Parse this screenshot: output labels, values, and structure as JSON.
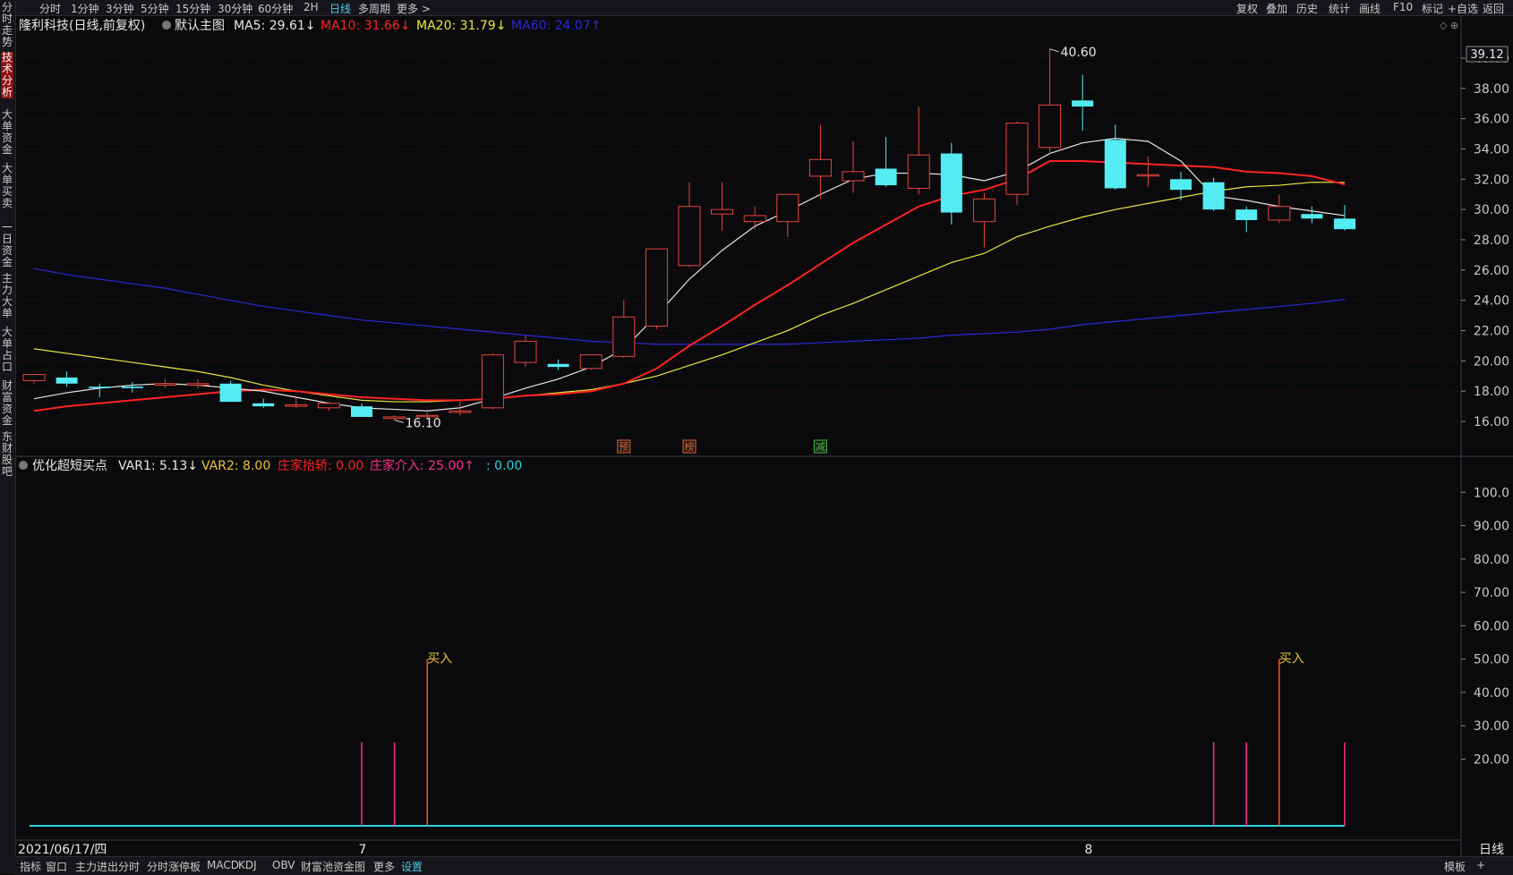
{
  "topbar": {
    "left_items": [
      "分时",
      "1分钟",
      "3分钟",
      "5分钟",
      "15分钟",
      "30分钟",
      "60分钟",
      "2H",
      "日线",
      "多周期",
      "更多 >"
    ],
    "selected": "日线",
    "right_items": [
      "复权",
      "叠加",
      "历史",
      "统计",
      "画线",
      "F10",
      "标记",
      "+自选",
      "返回"
    ]
  },
  "sidebar": {
    "tabs": [
      "分时走势",
      "技术分析",
      "大单资金",
      "大单买卖",
      "一日资金",
      "主力大单",
      "大单占口",
      "财富资金",
      "东财股吧"
    ],
    "active": "技术分析"
  },
  "colors": {
    "bg": "#0a0a0c",
    "up": "#e8453c",
    "down": "#54ecf2",
    "ma5": "#e6e6e6",
    "ma10": "#ff2222",
    "ma20": "#e8e840",
    "ma60": "#2a2ad8",
    "grid": "#3a0e0e",
    "axis": "#c8c8c8",
    "var": "#ff2f8f",
    "buy": "#ff5020",
    "buy_label": "#e8c040",
    "baseline": "#2fd0e0"
  },
  "price_panel": {
    "header": {
      "title": "隆利科技(日线,前复权)",
      "main_name": "默认主图",
      "ma5": "MA5: 29.61↓",
      "ma10": "MA10: 31.66↓",
      "ma20": "MA20: 31.79↓",
      "ma60": "MA60: 24.07↑"
    },
    "current_price": "39.12",
    "high_label": "40.60",
    "low_label": "16.10",
    "markers": [
      "预",
      "榜",
      "减"
    ]
  },
  "indicator_panel": {
    "header": {
      "name": "优化超短买点",
      "var1": "VAR1: 5.13↓",
      "var2": "VAR2: 8.00",
      "lift": "庄家抬轿: 0.00",
      "enter": "庄家介入: 25.00↑",
      "blank": ": 0.00"
    },
    "buy_label": "买入"
  },
  "xaxis": {
    "date": "2021/06/17/四",
    "month1": "7",
    "month2": "8",
    "period": "日线"
  },
  "bottombar": {
    "items": [
      "指标",
      "窗口",
      "主力进出分时",
      "分时涨停板",
      "MACD",
      "KDJ",
      "OBV",
      "财富池资金图",
      "更多",
      "设置"
    ],
    "right": [
      "模板",
      "+"
    ]
  },
  "chart_data": [
    {
      "type": "candlestick",
      "title": "隆利科技(日线,前复权)",
      "ylim": [
        15,
        41
      ],
      "yticks": [
        "16.00",
        "18.00",
        "20.00",
        "22.00",
        "24.00",
        "26.00",
        "28.00",
        "30.00",
        "32.00",
        "34.00",
        "36.00",
        "38.00",
        "40.00"
      ],
      "candles": [
        {
          "o": 18.7,
          "h": 19.1,
          "l": 18.5,
          "c": 19.1
        },
        {
          "o": 18.9,
          "h": 19.3,
          "l": 18.3,
          "c": 18.5
        },
        {
          "o": 18.3,
          "h": 18.5,
          "l": 17.6,
          "c": 18.2
        },
        {
          "o": 18.3,
          "h": 18.6,
          "l": 17.9,
          "c": 18.2
        },
        {
          "o": 18.4,
          "h": 18.8,
          "l": 18.2,
          "c": 18.5
        },
        {
          "o": 18.4,
          "h": 18.8,
          "l": 18.2,
          "c": 18.5
        },
        {
          "o": 18.5,
          "h": 18.7,
          "l": 17.3,
          "c": 17.3
        },
        {
          "o": 17.2,
          "h": 17.5,
          "l": 16.9,
          "c": 17.0
        },
        {
          "o": 17.0,
          "h": 17.6,
          "l": 16.9,
          "c": 17.1
        },
        {
          "o": 16.9,
          "h": 17.3,
          "l": 16.7,
          "c": 17.2
        },
        {
          "o": 17.0,
          "h": 17.2,
          "l": 16.3,
          "c": 16.3
        },
        {
          "o": 16.2,
          "h": 16.4,
          "l": 16.1,
          "c": 16.3
        },
        {
          "o": 16.4,
          "h": 16.6,
          "l": 16.2,
          "c": 16.4
        },
        {
          "o": 16.6,
          "h": 17.3,
          "l": 16.4,
          "c": 16.7
        },
        {
          "o": 16.9,
          "h": 20.5,
          "l": 16.8,
          "c": 20.4
        },
        {
          "o": 19.9,
          "h": 21.7,
          "l": 19.6,
          "c": 21.3
        },
        {
          "o": 19.8,
          "h": 20.1,
          "l": 19.4,
          "c": 19.6
        },
        {
          "o": 19.5,
          "h": 20.4,
          "l": 19.4,
          "c": 20.4
        },
        {
          "o": 20.3,
          "h": 24.0,
          "l": 20.2,
          "c": 22.9
        },
        {
          "o": 22.3,
          "h": 27.4,
          "l": 22.1,
          "c": 27.4
        },
        {
          "o": 26.3,
          "h": 31.8,
          "l": 26.2,
          "c": 30.2
        },
        {
          "o": 29.7,
          "h": 31.8,
          "l": 28.6,
          "c": 30.0
        },
        {
          "o": 29.2,
          "h": 30.2,
          "l": 28.7,
          "c": 29.6
        },
        {
          "o": 29.2,
          "h": 31.0,
          "l": 28.2,
          "c": 31.0
        },
        {
          "o": 32.2,
          "h": 35.6,
          "l": 30.7,
          "c": 33.3
        },
        {
          "o": 31.9,
          "h": 34.5,
          "l": 31.1,
          "c": 32.5
        },
        {
          "o": 32.7,
          "h": 34.8,
          "l": 31.5,
          "c": 31.6
        },
        {
          "o": 31.4,
          "h": 36.8,
          "l": 31.0,
          "c": 33.6
        },
        {
          "o": 33.7,
          "h": 34.4,
          "l": 29.0,
          "c": 29.8
        },
        {
          "o": 29.2,
          "h": 31.1,
          "l": 27.5,
          "c": 30.7
        },
        {
          "o": 31.0,
          "h": 35.8,
          "l": 30.3,
          "c": 35.7
        },
        {
          "o": 34.1,
          "h": 40.6,
          "l": 33.6,
          "c": 36.9
        },
        {
          "o": 37.2,
          "h": 38.9,
          "l": 35.2,
          "c": 36.8
        },
        {
          "o": 34.6,
          "h": 35.6,
          "l": 31.3,
          "c": 31.4
        },
        {
          "o": 32.3,
          "h": 33.5,
          "l": 31.5,
          "c": 32.3
        },
        {
          "o": 32.0,
          "h": 32.5,
          "l": 30.6,
          "c": 31.3
        },
        {
          "o": 31.8,
          "h": 32.1,
          "l": 29.9,
          "c": 30.0
        },
        {
          "o": 30.0,
          "h": 30.2,
          "l": 28.5,
          "c": 29.3
        },
        {
          "o": 29.3,
          "h": 31.0,
          "l": 29.1,
          "c": 30.2
        },
        {
          "o": 29.7,
          "h": 30.2,
          "l": 29.1,
          "c": 29.4
        },
        {
          "o": 29.4,
          "h": 30.3,
          "l": 28.6,
          "c": 28.7
        }
      ],
      "ma5": [
        17.5,
        17.9,
        18.2,
        18.4,
        18.5,
        18.4,
        18.2,
        18.0,
        17.6,
        17.2,
        16.9,
        16.8,
        16.7,
        16.9,
        17.5,
        18.2,
        18.8,
        19.6,
        20.8,
        23.0,
        25.4,
        27.3,
        28.9,
        29.9,
        31.0,
        32.0,
        32.4,
        32.4,
        32.3,
        31.9,
        32.5,
        33.7,
        34.4,
        34.7,
        34.5,
        33.2,
        30.9,
        30.6,
        30.2,
        29.9,
        29.6
      ],
      "ma10": [
        16.7,
        17.0,
        17.2,
        17.4,
        17.6,
        17.8,
        18.0,
        18.1,
        18.0,
        17.8,
        17.6,
        17.5,
        17.4,
        17.4,
        17.5,
        17.7,
        17.8,
        18.0,
        18.5,
        19.5,
        21.0,
        22.3,
        23.7,
        25.0,
        26.4,
        27.8,
        29.0,
        30.2,
        30.9,
        31.3,
        32.0,
        33.2,
        33.2,
        33.1,
        33.0,
        32.9,
        32.8,
        32.5,
        32.4,
        32.2,
        31.66
      ],
      "ma20": [
        20.8,
        20.5,
        20.2,
        19.9,
        19.6,
        19.3,
        18.9,
        18.4,
        18.0,
        17.7,
        17.4,
        17.3,
        17.3,
        17.4,
        17.5,
        17.7,
        17.9,
        18.1,
        18.5,
        19.0,
        19.7,
        20.4,
        21.2,
        22.0,
        23.0,
        23.8,
        24.7,
        25.6,
        26.5,
        27.1,
        28.2,
        28.9,
        29.5,
        30.0,
        30.4,
        30.8,
        31.2,
        31.5,
        31.6,
        31.8,
        31.79
      ],
      "ma60": [
        26.1,
        25.7,
        25.4,
        25.1,
        24.8,
        24.4,
        24.0,
        23.6,
        23.3,
        23.0,
        22.7,
        22.5,
        22.3,
        22.1,
        21.9,
        21.7,
        21.5,
        21.3,
        21.2,
        21.1,
        21.1,
        21.1,
        21.1,
        21.1,
        21.2,
        21.3,
        21.4,
        21.5,
        21.7,
        21.8,
        21.9,
        22.1,
        22.4,
        22.6,
        22.8,
        23.0,
        23.2,
        23.4,
        23.6,
        23.8,
        24.07
      ]
    },
    {
      "type": "bar",
      "title": "优化超短买点",
      "ylim": [
        0,
        110
      ],
      "yticks": [
        "20.00",
        "30.00",
        "40.00",
        "50.00",
        "60.00",
        "70.00",
        "80.00",
        "90.00",
        "100.0"
      ],
      "var_spikes": [
        {
          "index": 10,
          "value": 25
        },
        {
          "index": 11,
          "value": 25
        },
        {
          "index": 36,
          "value": 25
        },
        {
          "index": 37,
          "value": 25
        },
        {
          "index": 40,
          "value": 25
        }
      ],
      "buy_signals": [
        {
          "index": 12,
          "value": 50
        },
        {
          "index": 38,
          "value": 50
        }
      ],
      "baseline": 0
    }
  ]
}
